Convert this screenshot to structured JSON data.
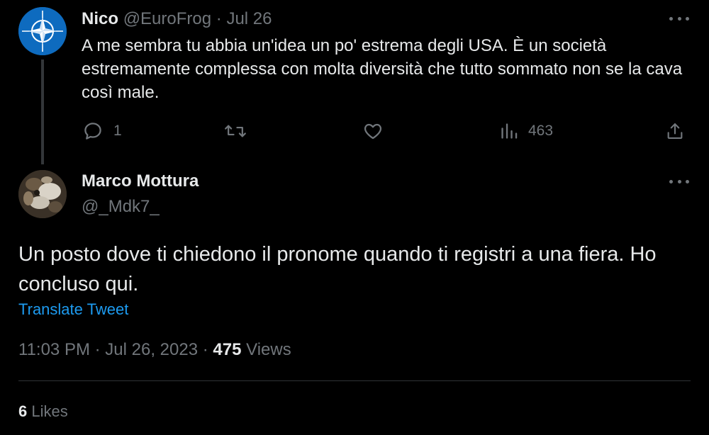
{
  "parent_tweet": {
    "author_name": "Nico",
    "author_handle": "@EuroFrog",
    "separator": "·",
    "date": "Jul 26",
    "text": "A me sembra tu abbia un'idea un po' estrema degli USA. È un società estremamente complessa con molta diversità che tutto sommato non se la cava così male.",
    "avatar_icon": "nato-compass-icon",
    "actions": {
      "reply_count": "1",
      "retweet_count": "",
      "like_count": "",
      "views_count": "463"
    }
  },
  "main_tweet": {
    "author_name": "Marco Mottura",
    "author_handle": "@_Mdk7_",
    "text": "Un posto dove ti chiedono il pronome quando ti registri a una fiera. Ho concluso qui.",
    "translate_label": "Translate Tweet",
    "time": "11:03 PM",
    "separator": "·",
    "date": "Jul 26, 2023",
    "views_count": "475",
    "views_label": "Views",
    "likes_count": "6",
    "likes_label": "Likes"
  },
  "colors": {
    "background": "#000000",
    "text_primary": "#e7e9ea",
    "text_secondary": "#71767b",
    "link": "#1d9bf0",
    "divider": "#2f3336",
    "nato_blue": "#0e6bbf"
  }
}
